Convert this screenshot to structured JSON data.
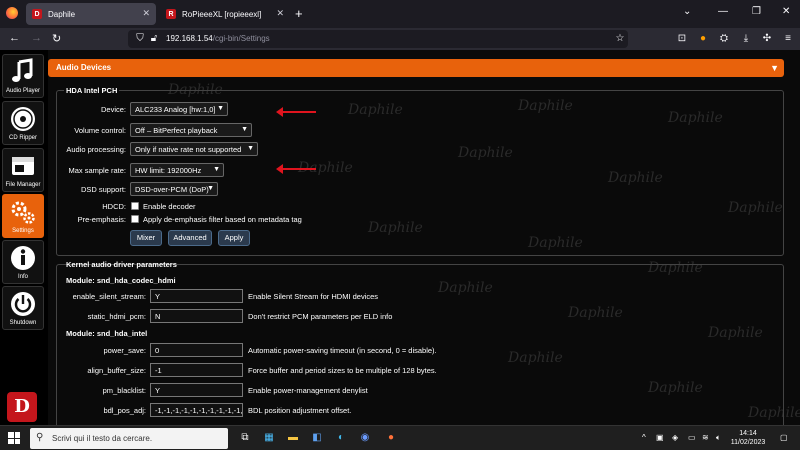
{
  "browser": {
    "tabs": [
      {
        "label": "Daphile",
        "active": true
      },
      {
        "label": "RoPieeeXL [ropieeexl]",
        "active": false
      }
    ],
    "new_tab": "+",
    "url_host": "192.168.1.54",
    "url_path": "/cgi-bin/Settings"
  },
  "sidebar": {
    "items": [
      {
        "label": "Audio Player",
        "icon": "music-note-icon",
        "active": false
      },
      {
        "label": "CD Ripper",
        "icon": "cd-disc-icon",
        "active": false
      },
      {
        "label": "File Manager",
        "icon": "file-manager-icon",
        "active": false
      },
      {
        "label": "Settings",
        "icon": "gears-icon",
        "active": true
      },
      {
        "label": "Info",
        "icon": "info-icon",
        "active": false
      },
      {
        "label": "Shutdown",
        "icon": "power-icon",
        "active": false
      }
    ],
    "logo": "D"
  },
  "audio_devices": {
    "title": "Audio Devices",
    "device_group": "HDA Intel PCH",
    "device_label": "Device:",
    "device_value": "ALC233 Analog [hw:1,0]",
    "volume_label": "Volume control:",
    "volume_value": "Off – BitPerfect playback",
    "processing_label": "Audio processing:",
    "processing_value": "Only if native rate not supported",
    "sample_rate_label": "Max sample rate:",
    "sample_rate_value": "HW limit: 192000Hz",
    "dsd_label": "DSD support:",
    "dsd_value": "DSD-over-PCM (DoP)",
    "hdcd_label": "HDCD:",
    "hdcd_text": "Enable decoder",
    "preemph_label": "Pre-emphasis:",
    "preemph_text": "Apply de-emphasis filter based on metadata tag",
    "buttons": {
      "mixer": "Mixer",
      "advanced": "Advanced",
      "apply": "Apply"
    }
  },
  "kernel": {
    "title": "Kernel audio driver parameters",
    "module1": "Module: snd_hda_codec_hdmi",
    "module2": "Module: snd_hda_intel",
    "params": [
      {
        "name": "enable_silent_stream:",
        "value": "Y",
        "desc": "Enable Silent Stream for HDMI devices"
      },
      {
        "name": "static_hdmi_pcm:",
        "value": "N",
        "desc": "Don't restrict PCM parameters per ELD info"
      },
      {
        "name": "power_save:",
        "value": "0",
        "desc": "Automatic power-saving timeout (in second, 0 = disable)."
      },
      {
        "name": "align_buffer_size:",
        "value": "-1",
        "desc": "Force buffer and period sizes to be multiple of 128 bytes."
      },
      {
        "name": "pm_blacklist:",
        "value": "Y",
        "desc": "Enable power-management denylist"
      },
      {
        "name": "bdl_pos_adj:",
        "value": "-1,-1,-1,-1,-1,-1,-1,-1,-1,-1,",
        "desc": "BDL position adjustment offset."
      }
    ]
  },
  "watermark": "Daphile",
  "taskbar": {
    "search_placeholder": "Scrivi qui il testo da cercare.",
    "time": "14:14",
    "date": "11/02/2023"
  }
}
